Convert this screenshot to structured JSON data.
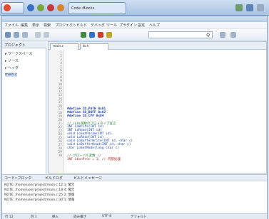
{
  "taskbar": {
    "tab_label": "Code::Blocks"
  },
  "search": {
    "value": "Q"
  },
  "editor": {
    "line_numbers": [
      "1",
      "2",
      "3",
      "4",
      "5",
      "6",
      "7",
      "8",
      "9",
      "10",
      "11",
      "12",
      "13",
      "14",
      "15",
      "16",
      "17",
      "18",
      "19",
      "20",
      "21",
      "22",
      "23",
      "24",
      "25",
      "26",
      "27",
      "28",
      "29",
      "30"
    ],
    "keyword_lines": [
      "#define CD_PATH 0x01",
      "#define CD_BUFF 0x02",
      "#define CD_CPP 0x04",
      "// (LB)関数のプロトタイプ宣言",
      "INT LoWrite(INT id)",
      "INT LoRead(INT id)",
      "void LoSetParam(INT id)",
      "void LoRead(INT id)",
      "void LoBufferWrite(INT id, char c)",
      "void LoBufferRead(INT id, char c)",
      "char LoSetMode(long char c)",
      "// グローバル変数 //",
      "INT LbonProc = 1; // 内部処理"
    ]
  },
  "bottom": {
    "tabs": [
      "コード::ブロック",
      "ビルドログ",
      "ビルドメッセージ"
    ],
    "messages": [
      "NOTE: /home/user/project/main.c:12:1: 警告",
      "NOTE: /home/user/project/main.c:18:4: 警告",
      "NOTE: /home/user/project/main.c:25:2: 情報",
      "NOTE: /home/user/project/main.c:30:1: 情報"
    ]
  },
  "status": {
    "items": [
      "行 12",
      "列 1",
      "挿入",
      "読み書き",
      "UTF-8",
      "デフォルト"
    ]
  }
}
